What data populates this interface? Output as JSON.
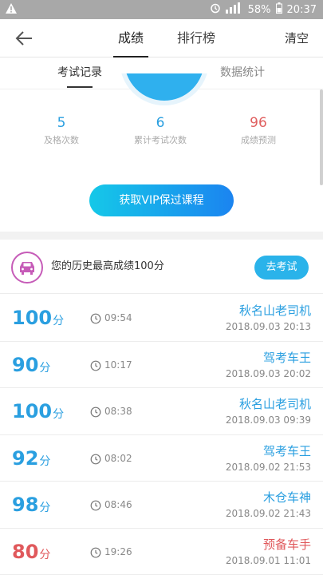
{
  "status_bar": {
    "battery": "58%",
    "time": "20:37",
    "icons": [
      "warning-icon",
      "alarm-icon",
      "signal-icon",
      "battery-icon"
    ]
  },
  "header": {
    "tabs": [
      "成绩",
      "排行榜"
    ],
    "active_tab": 0,
    "clear_label": "清空"
  },
  "subtabs": [
    "考试记录",
    "数据统计"
  ],
  "stats": [
    {
      "value": "5",
      "label": "及格次数"
    },
    {
      "value": "6",
      "label": "累计考试次数"
    },
    {
      "value": "96",
      "label": "成绩预测"
    }
  ],
  "vip_button": "获取VIP保过课程",
  "best": {
    "text": "您的历史最高成绩100分",
    "button": "去考试"
  },
  "records": [
    {
      "score": "100",
      "unit": "分",
      "duration": "09:54",
      "title": "秋名山老司机",
      "date": "2018.09.03  20:13",
      "color": "blue"
    },
    {
      "score": "90",
      "unit": "分",
      "duration": "10:17",
      "title": "驾考车王",
      "date": "2018.09.03  20:02",
      "color": "blue"
    },
    {
      "score": "100",
      "unit": "分",
      "duration": "08:38",
      "title": "秋名山老司机",
      "date": "2018.09.03  09:39",
      "color": "blue"
    },
    {
      "score": "92",
      "unit": "分",
      "duration": "08:02",
      "title": "驾考车王",
      "date": "2018.09.02  21:53",
      "color": "blue"
    },
    {
      "score": "98",
      "unit": "分",
      "duration": "08:46",
      "title": "木仓车神",
      "date": "2018.09.02  21:43",
      "color": "blue"
    },
    {
      "score": "80",
      "unit": "分",
      "duration": "19:26",
      "title": "预备车手",
      "date": "2018.09.01  11:01",
      "color": "red"
    }
  ],
  "colors": {
    "accent": "#2a9fe0",
    "fail": "#e0595c",
    "vip_start": "#15c8e8",
    "vip_end": "#1b84f0"
  }
}
